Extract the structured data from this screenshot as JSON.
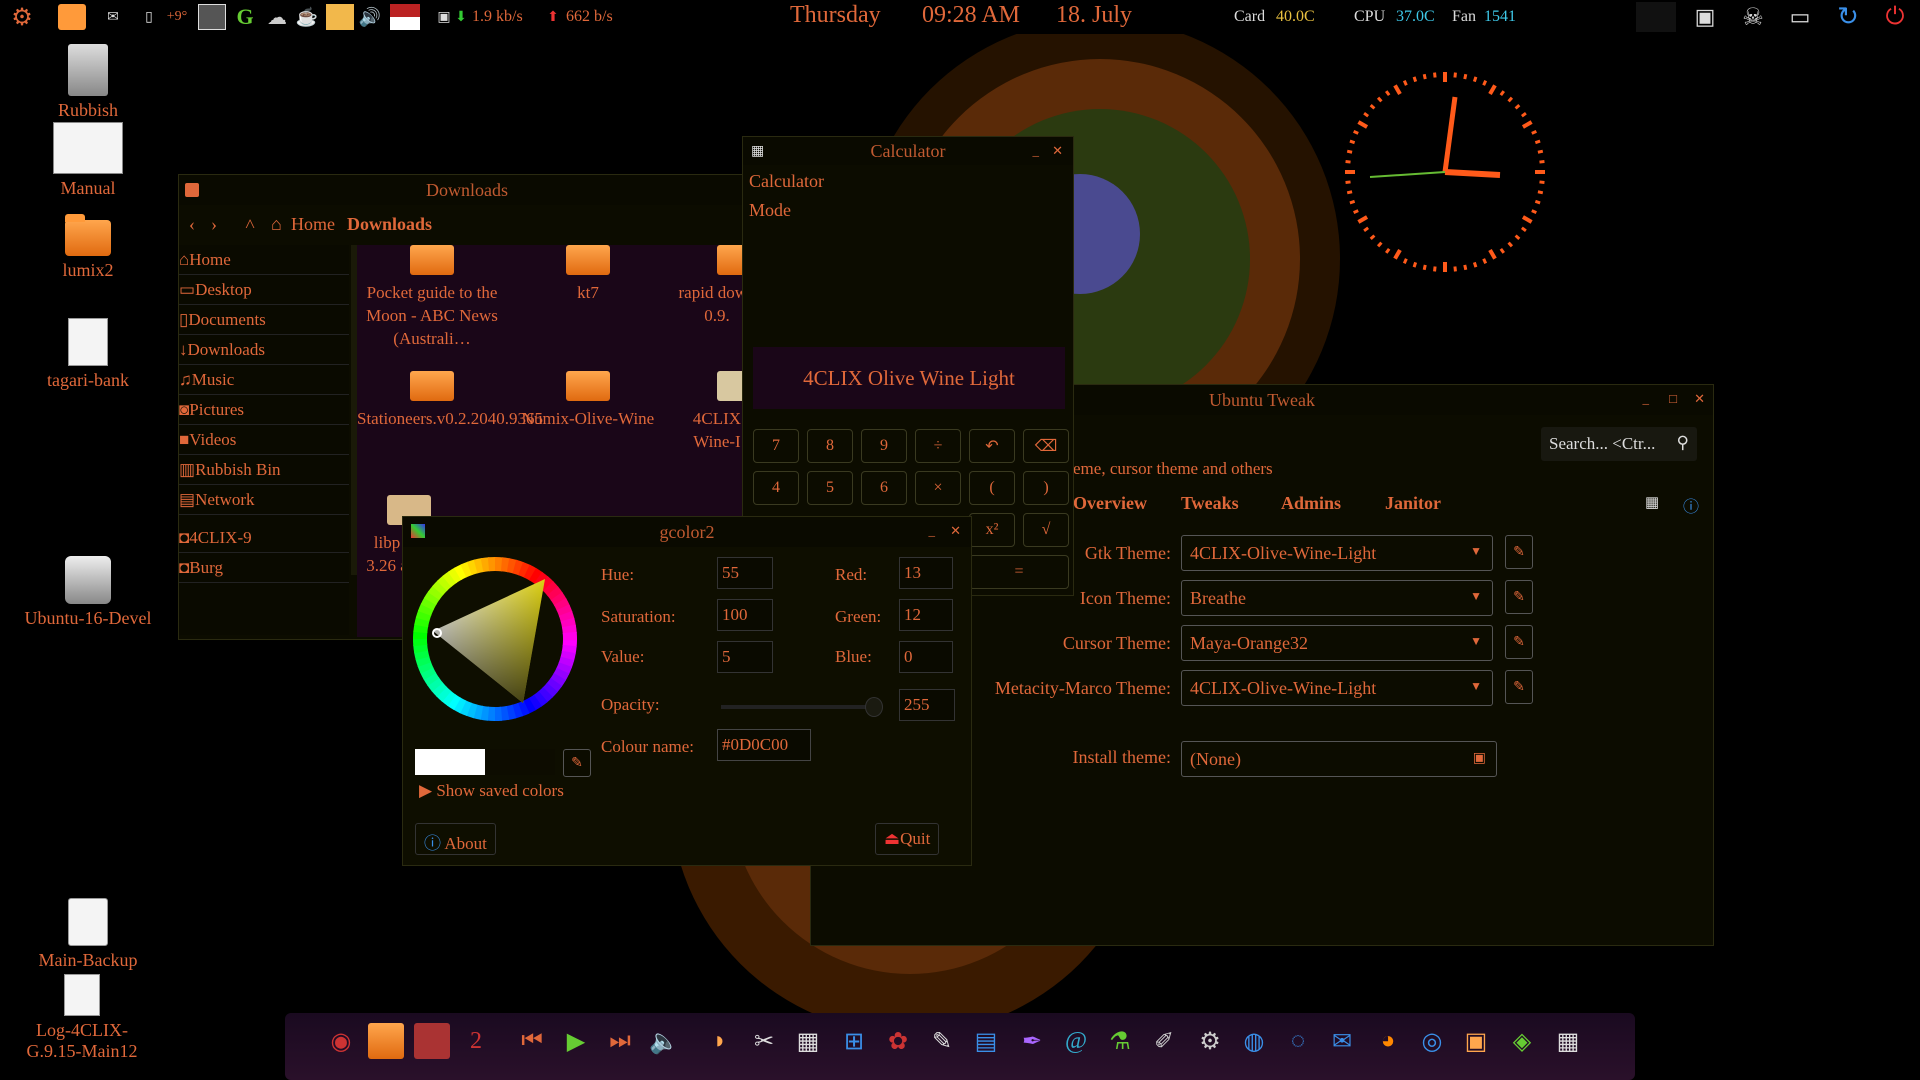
{
  "panel": {
    "weather": "+9°",
    "net_down": "1.9 kb/s",
    "net_up": "662 b/s",
    "day": "Thursday",
    "time": "09:28 AM",
    "date": "18. July",
    "card_label": "Card",
    "card_temp": "40.0C",
    "cpu_label": "CPU",
    "cpu_temp": "37.0C",
    "fan_label": "Fan",
    "fan_rpm": "1541"
  },
  "desktop": {
    "icons": [
      "Rubbish",
      "Manual",
      "lumix2",
      "tagari-bank",
      "Ubuntu-16-Devel",
      "Main-Backup",
      "Log-4CLIX-G.9.15-Main12"
    ]
  },
  "files": {
    "title": "Downloads",
    "crumb_home": "Home",
    "crumb_current": "Downloads",
    "sidebar": [
      "Home",
      "Desktop",
      "Documents",
      "Downloads",
      "Music",
      "Pictures",
      "Videos",
      "Rubbish Bin",
      "Network",
      "4CLIX-9",
      "Burg"
    ],
    "items": [
      "Pocket guide to the Moon - ABC News (Australi…",
      "kt7",
      "rapid down 0.9.",
      "Stationeers.v0.2.2040.9365",
      "Numix-Olive-Wine",
      "4CLIX Wine-I",
      "libp 3.26 a"
    ]
  },
  "calculator": {
    "title": "Calculator",
    "menu1": "Calculator",
    "menu2": "Mode",
    "display": "4CLIX Olive Wine Light",
    "keys": [
      "7",
      "8",
      "9",
      "÷",
      "↶",
      "⌫",
      "4",
      "5",
      "6",
      "×",
      "(",
      ")",
      "x²",
      "√",
      "="
    ]
  },
  "tweak": {
    "title": "Ubuntu Tweak",
    "search_placeholder": "Search... <Ctr...",
    "subtitle": "eme, cursor theme and others",
    "tabs": [
      "Overview",
      "Tweaks",
      "Admins",
      "Janitor"
    ],
    "rows": [
      {
        "label": "Gtk Theme:",
        "value": "4CLIX-Olive-Wine-Light"
      },
      {
        "label": "Icon Theme:",
        "value": "Breathe"
      },
      {
        "label": "Cursor Theme:",
        "value": "Maya-Orange32"
      },
      {
        "label": "Metacity-Marco Theme:",
        "value": "4CLIX-Olive-Wine-Light"
      }
    ],
    "install_label": "Install theme:",
    "install_value": "(None)"
  },
  "gcolor": {
    "title": "gcolor2",
    "hue_label": "Hue:",
    "hue": "55",
    "sat_label": "Saturation:",
    "sat": "100",
    "val_label": "Value:",
    "val": "5",
    "red_label": "Red:",
    "red": "13",
    "green_label": "Green:",
    "green": "12",
    "blue_label": "Blue:",
    "blue": "0",
    "opacity_label": "Opacity:",
    "opacity": "255",
    "name_label": "Colour name:",
    "name": "#0D0C00",
    "saved": "Show saved colors",
    "about": "About",
    "quit": "Quit"
  },
  "colors": {
    "accent": "#e0683a",
    "bg": "#0c0c00",
    "clock": "#ff5a1a"
  }
}
